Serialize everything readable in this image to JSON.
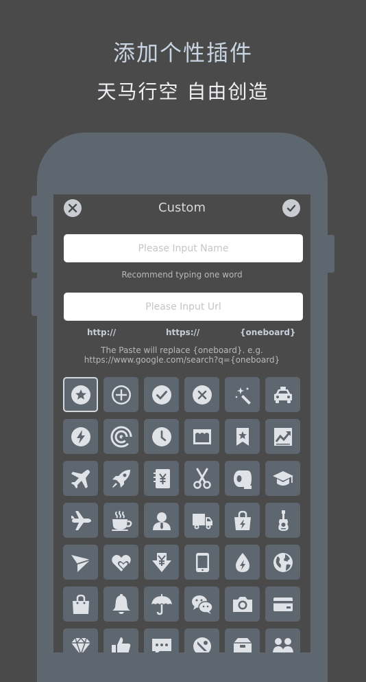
{
  "promo": {
    "headline": "添加个性插件",
    "subheadline": "天马行空 自由创造"
  },
  "dialog": {
    "title": "Custom",
    "name_placeholder": "Please Input Name",
    "name_hint": "Recommend typing one word",
    "url_placeholder": "Please Input Url",
    "shortcuts": [
      "http://",
      "https://",
      "{oneboard}"
    ],
    "paste_hint_line1": "The Paste will replace {oneboard}. e.g.",
    "paste_hint_line2": "https://www.google.com/search?q={oneboard}"
  },
  "icons": [
    "star-circle-icon",
    "plus-circle-icon",
    "check-circle-icon",
    "x-circle-icon",
    "magic-wand-icon",
    "taxi-icon",
    "lightning-circle-icon",
    "target-icon",
    "clock-icon",
    "shop-icon",
    "bookmark-star-icon",
    "trend-chart-icon",
    "plane-icon",
    "rocket-icon",
    "yen-notebook-icon",
    "scissors-icon",
    "toilet-paper-icon",
    "graduation-cap-icon",
    "airplane-icon",
    "coffee-cup-icon",
    "person-icon",
    "truck-icon",
    "charging-bag-icon",
    "guitar-icon",
    "paper-plane-icon",
    "heart-icon",
    "yen-download-icon",
    "tablet-icon",
    "water-drop-icon",
    "globe-icon",
    "shopping-bag-icon",
    "bell-icon",
    "umbrella-icon",
    "wechat-icon",
    "camera-icon",
    "credit-card-icon",
    "diamond-icon",
    "thumb-up-icon",
    "chat-dots-icon",
    "food-icon",
    "box-icon",
    "group-icon"
  ],
  "selected_icon_index": 0,
  "colors": {
    "background": "#4a4a4a",
    "phone": "#5e6670",
    "tile": "#5e6670",
    "glyph": "#dfe2e6",
    "shortcut_text": "#c6ced8"
  }
}
